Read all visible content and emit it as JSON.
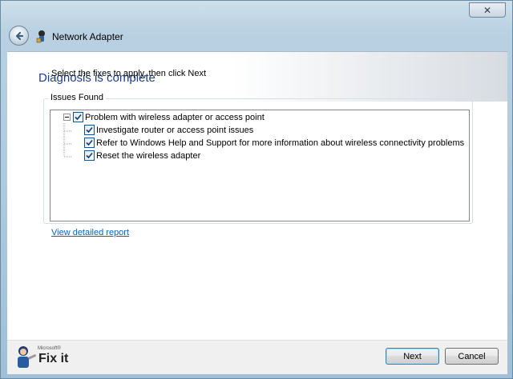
{
  "window": {
    "title": "Network Adapter",
    "close_symbol": "✕"
  },
  "header": {
    "heading": "Diagnosis is complete"
  },
  "main": {
    "instruction": "Select the fixes to apply, then click Next",
    "group_label": "Issues Found",
    "tree": {
      "root": {
        "label": "Problem with wireless adapter or access point",
        "checked": true,
        "expanded": true
      },
      "children": [
        {
          "label": "Investigate router or access point issues",
          "checked": true
        },
        {
          "label": "Refer to Windows Help and Support for more information about wireless connectivity problems",
          "checked": true
        },
        {
          "label": "Reset the wireless adapter",
          "checked": true
        }
      ]
    },
    "report_link": "View detailed report"
  },
  "footer": {
    "brand_small": "Microsoft®",
    "brand_main": "Fix it",
    "next_label": "Next",
    "cancel_label": "Cancel"
  },
  "icons": {
    "back": "back-arrow-icon",
    "app": "network-adapter-icon",
    "checkbox": "checkmark-icon",
    "collapse": "minus-icon"
  },
  "colors": {
    "heading": "#1e3c8c",
    "link": "#0066cc",
    "default_button_border": "#3c7fb1"
  }
}
